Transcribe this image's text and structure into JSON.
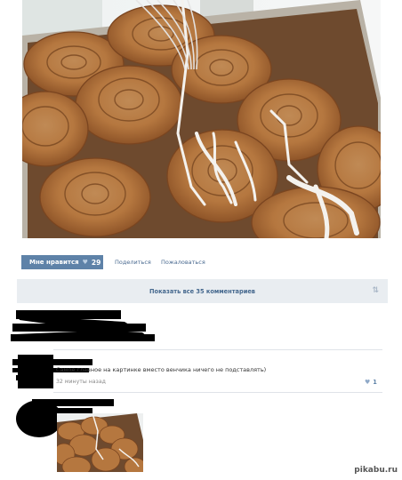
{
  "post": {
    "image_alt": "cinnamon-rolls-photo",
    "actions": {
      "like_label": "Мне нравится",
      "like_count": "29",
      "share_label": "Поделиться",
      "report_label": "Пожаловаться"
    }
  },
  "comments": {
    "show_all_label": "Показать все 35 комментариев",
    "items": [
      {
        "text": "Самое главное на картинке вместо венчика ничего не подставлять)",
        "time": "32 минуты назад",
        "likes": "1"
      }
    ]
  },
  "watermark": "pikabu.ru",
  "icons": {
    "like": "heart-icon",
    "toggle": "collapse-icon"
  }
}
